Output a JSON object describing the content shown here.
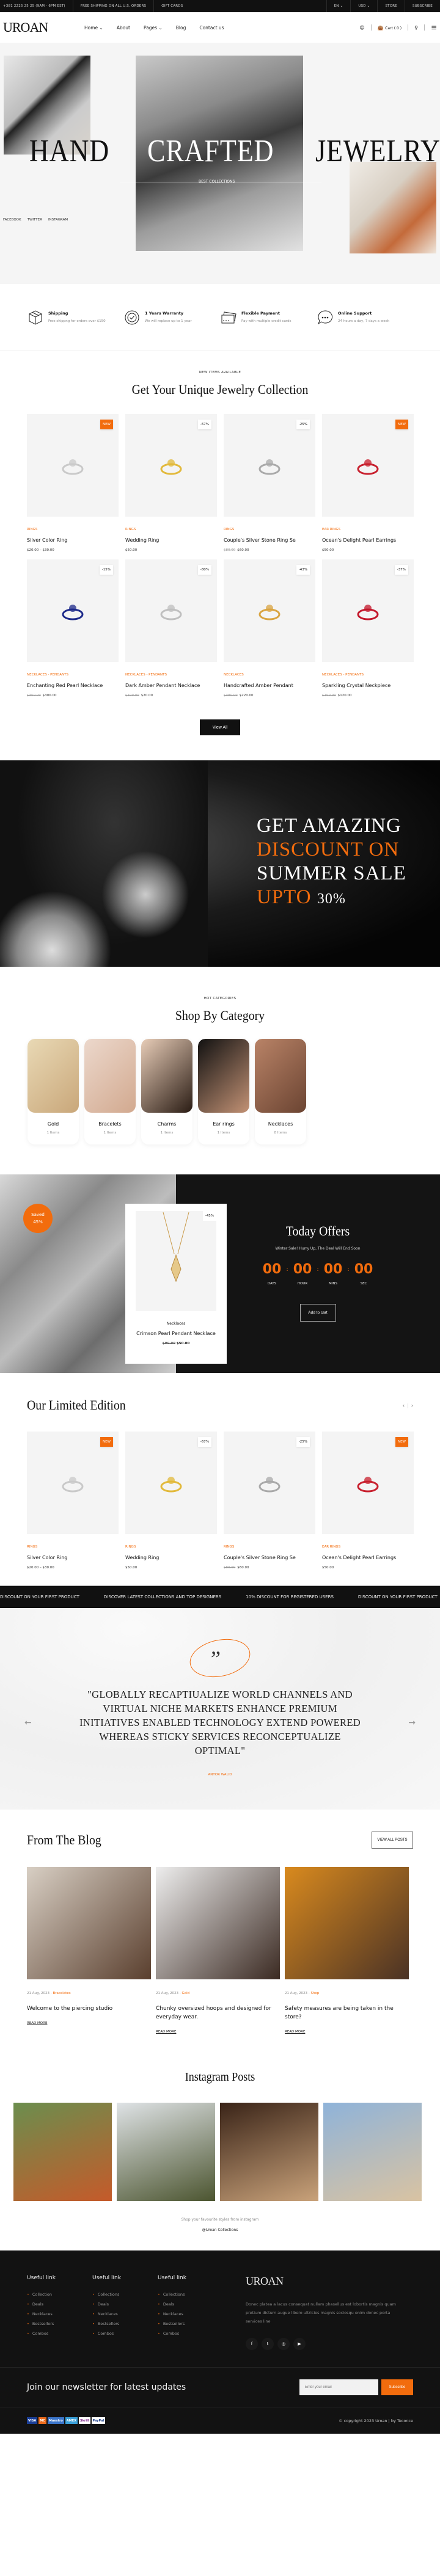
{
  "topbar": {
    "phone": "+381 2225 25 25 (9AM - 6PM EST)",
    "shipping": "FREE SHIPPING ON ALL U.S. ORDERS",
    "gift": "GIFT CARDS",
    "lang": "EN ⌄",
    "currency": "USD ⌄",
    "store": "STORE",
    "subscribe": "SUBSCRIBE"
  },
  "header": {
    "logo": "UROAN",
    "nav": [
      "Home ⌄",
      "About",
      "Pages ⌄",
      "Blog",
      "Contact us"
    ],
    "cart": "Cart ( 0 )"
  },
  "hero": {
    "word1": "HAND",
    "word2": "CRAFTED",
    "word3": "JEWELRY",
    "tagline": "BEST COLLECTIONS",
    "social": [
      "FACEBOOK",
      "TWITTER",
      "INSTAGRAM"
    ]
  },
  "features": [
    {
      "title": "Shipping",
      "desc": "Free shippng for orders over $150",
      "icon": "box-icon"
    },
    {
      "title": "1 Years Warranty",
      "desc": "We will replace up to 1 year",
      "icon": "badge-check-icon"
    },
    {
      "title": "Flexible Payment",
      "desc": "Pay with multiple credit cards",
      "icon": "credit-card-icon"
    },
    {
      "title": "Online Support",
      "desc": "24 hours a day, 7 days a week",
      "icon": "chat-bubble-icon"
    }
  ],
  "collection": {
    "eyebrow": "NEW ITEMS AVAILABLE",
    "title": "Get Your Unique Jewelry Collection",
    "view_all": "View All",
    "products": [
      {
        "badge": "NEW",
        "badge_new": true,
        "category": "RINGS",
        "name": "Silver Color Ring",
        "old": "",
        "price": "$20.00 – $30.00",
        "color": "#c9c9c9"
      },
      {
        "badge": "-67%",
        "badge_new": false,
        "category": "RINGS",
        "name": "Wedding Ring",
        "old": "",
        "price": "$50.00",
        "color": "#e2b93b"
      },
      {
        "badge": "-25%",
        "badge_new": false,
        "category": "RINGS",
        "name": "Couple's Silver Stone Ring Se",
        "old": "$80.00",
        "price": "$60.00",
        "color": "#a9a9a9"
      },
      {
        "badge": "NEW",
        "badge_new": true,
        "category": "EAR RINGS",
        "name": "Ocean's Delight Pearl Earrings",
        "old": "",
        "price": "$50.00",
        "color": "#c8202e"
      },
      {
        "badge": "-15%",
        "badge_new": false,
        "category": "NECKLACES - PENDANTS",
        "name": "Enchanting Red Pearl Necklace",
        "old": "$350.00",
        "price": "$300.00",
        "color": "#1d2a8a"
      },
      {
        "badge": "-80%",
        "badge_new": false,
        "category": "NECKLACES - PENDANTS",
        "name": "Dark Amber Pendant Necklace",
        "old": "$100.00",
        "price": "$20.00",
        "color": "#bfbfbf"
      },
      {
        "badge": "-43%",
        "badge_new": false,
        "category": "NECKLACES",
        "name": "Handcrafted Amber Pendant",
        "old": "$380.00",
        "price": "$220.00",
        "color": "#d9a441"
      },
      {
        "badge": "-37%",
        "badge_new": false,
        "category": "NECKLACES - PENDANTS",
        "name": "Sparkling Crystal Neckpiece",
        "old": "$190.00",
        "price": "$120.00",
        "color": "#c3172b"
      }
    ]
  },
  "promo": {
    "line1": "GET AMAZING",
    "line2": "DISCOUNT ON",
    "line3": "SUMMER SALE",
    "line4a": "UPTO",
    "line4b": "30%"
  },
  "categories": {
    "eyebrow": "HOT CATEGORIES",
    "title": "Shop By Category",
    "items": [
      {
        "name": "Gold",
        "count": "1 Items",
        "c1": "#e9d9b5",
        "c2": "#c9a77a"
      },
      {
        "name": "Bracelets",
        "count": "1 Items",
        "c1": "#ecd8cc",
        "c2": "#d2a98f"
      },
      {
        "name": "Charms",
        "count": "1 Items",
        "c1": "#e8cdb8",
        "c2": "#2a1c14"
      },
      {
        "name": "Ear rings",
        "count": "1 Items",
        "c1": "#111",
        "c2": "#c39275"
      },
      {
        "name": "Necklaces",
        "count": "8 Items",
        "c1": "#b98367",
        "c2": "#6b4432"
      }
    ]
  },
  "offers": {
    "saved": "Saved",
    "saved_pct": "45%",
    "badge": "-45%",
    "category": "Necklaces",
    "name": "Crimson Pearl Pendant Necklace",
    "old": "$90.00",
    "price": "$50.00",
    "title": "Today Offers",
    "subtitle": "Winter Sale! Hurry Up, The Deal Will End Soon",
    "countdown": [
      {
        "n": "00",
        "l": "DAYS"
      },
      {
        "n": "00",
        "l": "HOUR"
      },
      {
        "n": "00",
        "l": "MINS"
      },
      {
        "n": "00",
        "l": "SEC"
      }
    ],
    "add_to_cart": "Add to cart"
  },
  "limited": {
    "title": "Our Limited Edition",
    "prev": "‹",
    "next": "›"
  },
  "marquee": [
    "DISCOUNT ON YOUR FIRST PRODUCT",
    "DISCOVER LATEST COLLECTIONS AND TOP DESIGNERS",
    "10% DISCOUNT FOR REGISTERED USERS"
  ],
  "testimonial": {
    "quote": "\"Globally recaptiualize world channels and virtual niche markets enhance premium initiatives enabled technology extend powered whereas sticky services reconceptualize optimal\"",
    "author": "ANTOR WALID",
    "prev": "←",
    "next": "→"
  },
  "blog": {
    "title": "From The Blog",
    "view_all": "VIEW ALL POSTS",
    "posts": [
      {
        "date": "21 Aug, 2023 - ",
        "cat": "Bracelates",
        "title": "Welcome to the piercing studio",
        "read": "READ MORE",
        "c1": "#d8cfc4",
        "c2": "#5a3f2e"
      },
      {
        "date": "21 Aug, 2023 - ",
        "cat": "Gold",
        "title": "Chunky oversized hoops and designed for everyday wear.",
        "read": "READ MORE",
        "c1": "#eee",
        "c2": "#3b2a22"
      },
      {
        "date": "21 Aug, 2023 - ",
        "cat": "Shop",
        "title": "Safety measures are being taken in the store?",
        "read": "READ MORE",
        "c1": "#d98a1e",
        "c2": "#4a3225"
      }
    ]
  },
  "instagram": {
    "title": "Instagram Posts",
    "sub": "Shop your favourite styles from instagram",
    "handle": "@Uroan Collections",
    "posts": [
      {
        "c1": "#6b8e4e",
        "c2": "#c55a2a"
      },
      {
        "c1": "#dfe3e6",
        "c2": "#4c5530"
      },
      {
        "c1": "#3a2418",
        "c2": "#c9a27a"
      },
      {
        "c1": "#8fb3d9",
        "c2": "#d9c3a2"
      }
    ]
  },
  "footer": {
    "cols": [
      {
        "title": "Useful link",
        "items": [
          "Collection",
          "Deals",
          "Necklaces",
          "Bestsellers",
          "Combos"
        ]
      },
      {
        "title": "Useful link",
        "items": [
          "Collections",
          "Deals",
          "Necklaces",
          "Bestsellers",
          "Combos"
        ]
      },
      {
        "title": "Useful link",
        "items": [
          "Collections",
          "Deals",
          "Necklaces",
          "Bestsellers",
          "Combos"
        ]
      }
    ],
    "logo": "UROAN",
    "about": "Donec platea a lacus consequat nullam phasellus est lobortis magnis quam pretium dictum augue libero ultricies magnis sociosqu enim donec porta services line",
    "social": [
      "f",
      "t",
      "◎",
      "▶"
    ],
    "newsletter": "Join our newsletter for latest updates",
    "email_placeholder": "Enter your email",
    "subscribe": "Subscribe",
    "payments": [
      "VISA",
      "MC",
      "Maestro",
      "AMEX",
      "Skrill",
      "PayPal"
    ],
    "copyright": "© copyright 2023 Uroan | by Teconce"
  },
  "colors": {
    "accent": "#f26c0d",
    "dark": "#111111"
  }
}
